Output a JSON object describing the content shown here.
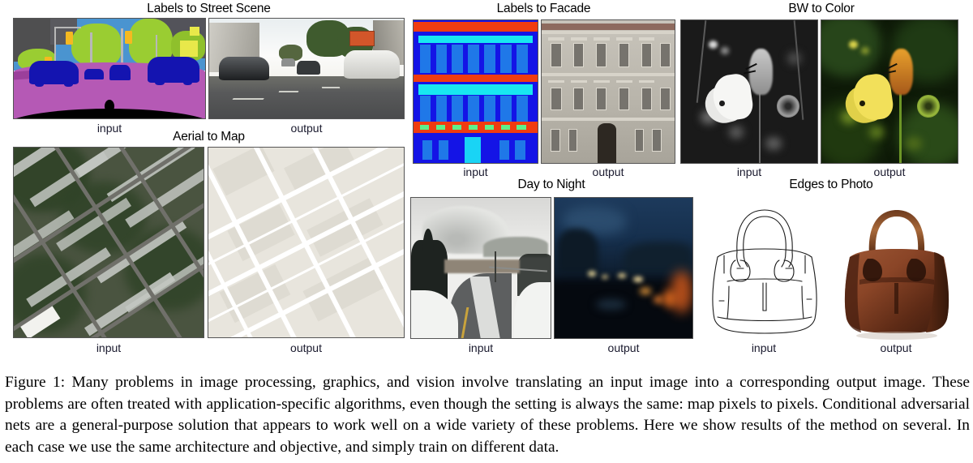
{
  "figure": {
    "caption": "Figure 1: Many problems in image processing, graphics, and vision involve translating an input image into a corresponding output image. These problems are often treated with application-specific algorithms, even though the setting is always the same: map pixels to pixels. Conditional adversarial nets are a general-purpose solution that appears to work well on a wide variety of these problems. Here we show results of the method on several. In each case we use the same architecture and objective, and simply train on different data."
  },
  "panels": [
    {
      "id": "labels-to-street-scene",
      "title": "Labels to Street Scene",
      "input_label": "input",
      "output_label": "output",
      "input_kind": "semantic-segmentation-map",
      "output_kind": "photograph-street"
    },
    {
      "id": "aerial-to-map",
      "title": "Aerial to Map",
      "input_label": "input",
      "output_label": "output",
      "input_kind": "aerial-satellite-photo",
      "output_kind": "street-map-render"
    },
    {
      "id": "labels-to-facade",
      "title": "Labels to Facade",
      "input_label": "input",
      "output_label": "output",
      "input_kind": "facade-label-map",
      "output_kind": "photograph-building-facade"
    },
    {
      "id": "day-to-night",
      "title": "Day to Night",
      "input_label": "input",
      "output_label": "output",
      "input_kind": "photograph-daytime-mountain-road",
      "output_kind": "photograph-nighttime-mountain-road"
    },
    {
      "id": "bw-to-color",
      "title": "BW to Color",
      "input_label": "input",
      "output_label": "output",
      "input_kind": "grayscale-butterfly-photo",
      "output_kind": "color-butterfly-photo"
    },
    {
      "id": "edges-to-photo",
      "title": "Edges to Photo",
      "input_label": "input",
      "output_label": "output",
      "input_kind": "edge-sketch-handbag",
      "output_kind": "photograph-leather-handbag"
    }
  ],
  "colors": {
    "label_road": "#b559b5",
    "label_car": "#1414b0",
    "label_vegetation": "#9acd32",
    "label_sky": "#4a94d0",
    "label_building": "#4f4f50",
    "facade_background": "#1414e6",
    "facade_cornice": "#f03c10",
    "facade_window": "#1f78e8",
    "facade_sill": "#18e8f0",
    "facade_shop": "#5ef08a",
    "map_background": "#e8e5dd",
    "map_road": "#ffffff",
    "night_sky": "#1d3a5c",
    "bag_leather": "#8b4a2f",
    "text": "#000000"
  }
}
